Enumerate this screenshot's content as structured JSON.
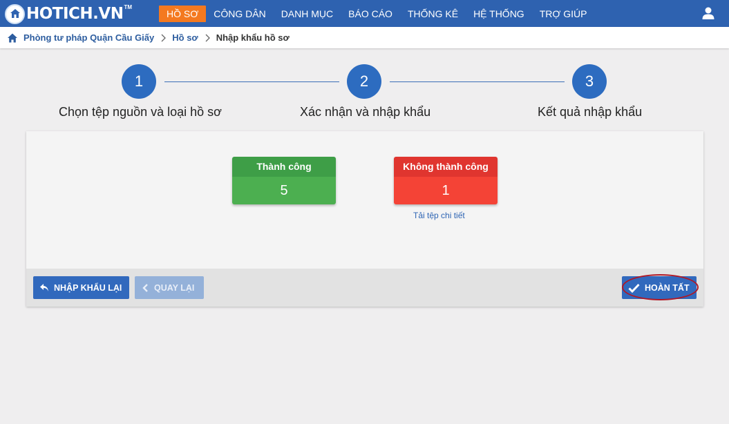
{
  "brand": {
    "logo_text": "HOTICH.VN",
    "logo_tm": "TM"
  },
  "nav": {
    "items": [
      {
        "label": "HỒ SƠ",
        "active": true
      },
      {
        "label": "CÔNG DÂN",
        "active": false
      },
      {
        "label": "DANH MỤC",
        "active": false
      },
      {
        "label": "BÁO CÁO",
        "active": false
      },
      {
        "label": "THỐNG KÊ",
        "active": false
      },
      {
        "label": "HỆ THỐNG",
        "active": false
      },
      {
        "label": "TRỢ GIÚP",
        "active": false
      }
    ],
    "user_icon": "user-icon"
  },
  "breadcrumb": {
    "home_icon": "home-icon",
    "items": [
      "Phòng tư pháp Quận Cầu Giấy",
      "Hồ sơ",
      "Nhập khẩu hồ sơ"
    ]
  },
  "stepper": {
    "steps": [
      {
        "number": "1",
        "label": "Chọn tệp nguồn và loại hồ sơ"
      },
      {
        "number": "2",
        "label": "Xác nhận và nhập khẩu"
      },
      {
        "number": "3",
        "label": "Kết quả nhập khẩu"
      }
    ]
  },
  "results": {
    "success": {
      "label": "Thành công",
      "value": "5",
      "color": "#4caf50"
    },
    "failure": {
      "label": "Không thành công",
      "value": "1",
      "color": "#f44336"
    },
    "detail_link": "Tải tệp chi tiết"
  },
  "footer": {
    "reimport_label": "NHẬP KHẨU LẠI",
    "back_label": "QUAY LẠI",
    "finish_label": "HOÀN TẤT"
  },
  "colors": {
    "primary": "#2e62b0",
    "active_menu": "#f47920",
    "highlight_ring": "#b01825"
  }
}
